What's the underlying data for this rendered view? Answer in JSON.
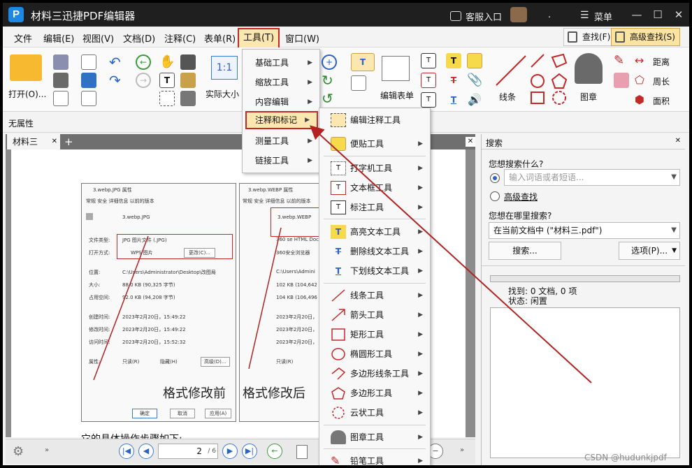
{
  "titlebar": {
    "title": "材料三迅捷PDF编辑器",
    "service": "客服入口",
    "dot": ".",
    "menu": "菜单"
  },
  "menubar": {
    "items": [
      "文件",
      "编辑(E)",
      "视图(V)",
      "文档(D)",
      "注释(C)",
      "表单(R)"
    ],
    "tools": "工具(T)",
    "window": "窗口(W)",
    "find": "查找(F)",
    "adv_find": "高级查找(S)"
  },
  "ribbon": {
    "open": "打开(O)...",
    "actual_size": "实际大小",
    "edit_form": "编辑表单",
    "line": "线条",
    "stamp": "图章",
    "distance": "距离",
    "perimeter": "周长",
    "area": "面积"
  },
  "props": {
    "label": "无属性"
  },
  "tab": {
    "name": "材料三",
    "plus": "+",
    "close": "✕"
  },
  "document": {
    "left_caption": "格式修改前",
    "right_caption": "格式修改后",
    "body_text": "它的具体操作步骤如下:",
    "left_shot": {
      "title": "3.webp.JPG 属性",
      "tabs": "常规 安全 详细信息 以前的版本",
      "filename": "3.webp.JPG",
      "type_label": "文件类型:",
      "type_value": "JPG 图片文件 (.JPG)",
      "open_label": "打开方式:",
      "open_value": "WPS 图片",
      "change": "更改(C)...",
      "loc_label": "位置:",
      "loc_value": "C:\\Users\\Administrator\\Desktop\\改图局",
      "size_label": "大小:",
      "size_value": "88.0 KB (90,325 字节)",
      "disk_label": "占用空间:",
      "disk_value": "92.0 KB (94,208 字节)",
      "created_label": "创建时间:",
      "created_value": "2023年2月20日，15:49:22",
      "modified_label": "修改时间:",
      "modified_value": "2023年2月20日，15:49:22",
      "accessed_label": "访问时间:",
      "accessed_value": "2023年2月20日，15:52:32",
      "attr_label": "属性:",
      "readonly": "只读(R)",
      "hidden": "隐藏(H)",
      "advanced": "高级(D)...",
      "ok": "确定",
      "cancel": "取消",
      "apply": "应用(A)"
    },
    "right_shot": {
      "title": "3.webp.WEBP 属性",
      "tabs": "常规 安全 详细信息 以前的版本",
      "filename": "3.webp.WEBP",
      "type_value": "360 se HTML Doc",
      "open_value": "360安全浏览器",
      "loc_value": "C:\\Users\\Admini",
      "size_value": "102 KB (104,642 字",
      "disk_value": "104 KB (106,496 字",
      "created_value": "2023年2月20日，",
      "modified_value": "2023年2月20日，",
      "accessed_value": "2023年2月20日，",
      "readonly": "只读(R)"
    }
  },
  "nav": {
    "page_value": "2",
    "page_total": "/ 6"
  },
  "tools_menu": {
    "items": [
      "基础工具",
      "缩放工具",
      "内容编辑",
      "注释和标记",
      "测量工具",
      "链接工具"
    ]
  },
  "annot_menu": {
    "items": [
      "编辑注释工具",
      "便贴工具",
      "打字机工具",
      "文本框工具",
      "标注工具",
      "高亮文本工具",
      "删除线文本工具",
      "下划线文本工具",
      "线条工具",
      "箭头工具",
      "矩形工具",
      "椭圆形工具",
      "多边形线条工具",
      "多边形工具",
      "云状工具",
      "图章工具",
      "铅笔工具"
    ]
  },
  "search": {
    "header": "搜索",
    "question": "您想搜索什么?",
    "placeholder": "输入词语或者短语...",
    "adv": "高级查找",
    "where": "您想在哪里搜索?",
    "scope": "在当前文档中 (\"材料三.pdf\")",
    "search_btn": "搜索...",
    "options_btn": "选项(P)...",
    "found": "找到: 0 文档, 0 项",
    "status": "状态: 闲置"
  },
  "watermark": "CSDN @hudunkjpdf",
  "colors": {
    "accent_red": "#c62828",
    "highlight": "#fde7b0"
  }
}
